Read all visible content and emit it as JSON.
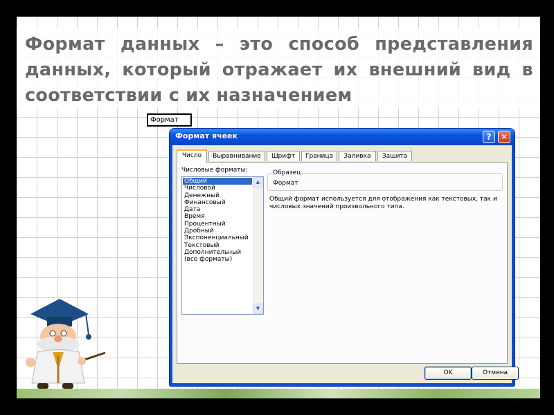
{
  "slide": {
    "heading": "Формат данных – это способ представления данных, который отражает их внешний вид в соответствии с их назначением"
  },
  "sheet": {
    "cell_text": "Формат"
  },
  "dialog": {
    "title": "Формат ячеек",
    "help_label": "?",
    "close_label": "✕",
    "tabs": [
      {
        "label": "Число"
      },
      {
        "label": "Выравнивание"
      },
      {
        "label": "Шрифт"
      },
      {
        "label": "Граница"
      },
      {
        "label": "Заливка"
      },
      {
        "label": "Защита"
      }
    ],
    "active_tab": "Число",
    "formats_label": "Числовые форматы:",
    "formats": [
      "Общий",
      "Числовой",
      "Денежный",
      "Финансовый",
      "Дата",
      "Время",
      "Процентный",
      "Дробный",
      "Экспоненциальный",
      "Текстовый",
      "Дополнительный",
      "(все форматы)"
    ],
    "selected_format": "Общий",
    "sample_title": "Образец",
    "sample_value": "Формат",
    "description": "Общий формат используется для отображения как текстовых, так и числовых значений произвольного типа.",
    "ok_label": "OK",
    "cancel_label": "Отмена"
  },
  "colors": {
    "titlebar": "#0a53e0",
    "selection": "#316ac5",
    "heading_text": "#6a6a6a",
    "active_tab_accent": "#f7b63a"
  },
  "icons": [
    "help-icon",
    "close-icon",
    "scroll-up-icon",
    "scroll-down-icon",
    "professor-mascot"
  ]
}
